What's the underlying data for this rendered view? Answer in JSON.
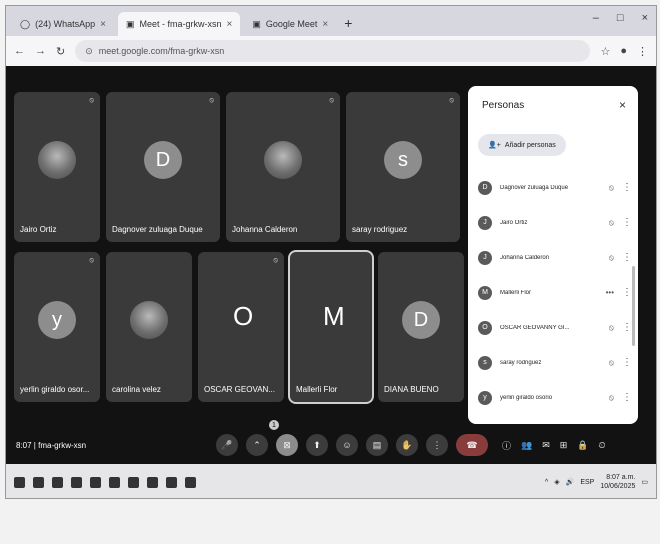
{
  "browser": {
    "tabs": [
      {
        "label": "(24) WhatsApp",
        "active": false
      },
      {
        "label": "Meet - fma-grkw-xsn",
        "active": true
      },
      {
        "label": "Google Meet",
        "active": false
      }
    ],
    "url": "meet.google.com/fma-grkw-xsn"
  },
  "meeting": {
    "code": "fma-grkw-xsn",
    "clock": "8:07",
    "tiles": [
      {
        "name": "Jairo Ortiz",
        "initial": "",
        "photo": true
      },
      {
        "name": "Dagnover zuluaga Duque",
        "initial": "D",
        "photo": false
      },
      {
        "name": "Johanna Calderon",
        "initial": "",
        "photo": true
      },
      {
        "name": "saray rodriguez",
        "initial": "s",
        "photo": false
      },
      {
        "name": "yerlin giraldo osor...",
        "initial": "y",
        "photo": false
      },
      {
        "name": "carolina velez",
        "initial": "",
        "photo": true
      },
      {
        "name": "OSCAR GEOVAN...",
        "initial": "O",
        "photo": false
      },
      {
        "name": "Mallerli Flor",
        "initial": "M",
        "photo": false
      },
      {
        "name": "DIANA BUENO",
        "initial": "D",
        "photo": false
      }
    ],
    "raise_hand_count": "1"
  },
  "people_panel": {
    "title": "Personas",
    "add_label": "Añadir personas",
    "list": [
      {
        "name": "Dagnover zuluaga Duque",
        "initial": "D"
      },
      {
        "name": "Jairo Ortiz",
        "initial": "J"
      },
      {
        "name": "Johanna Calderon",
        "initial": "J"
      },
      {
        "name": "Mallerli Flor",
        "initial": "M"
      },
      {
        "name": "OSCAR GEOVANNY GI...",
        "initial": "O"
      },
      {
        "name": "saray rodriguez",
        "initial": "s"
      },
      {
        "name": "yerlin giraldo osorio",
        "initial": "y"
      }
    ]
  },
  "taskbar": {
    "time": "8:07 a.m.",
    "date": "10/06/2025",
    "lang": "ESP"
  }
}
